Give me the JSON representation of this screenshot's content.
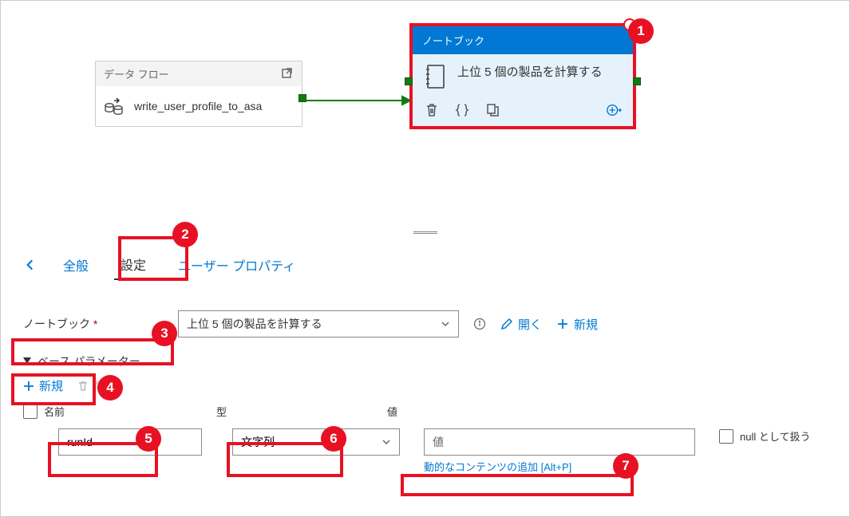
{
  "canvas": {
    "dataflow": {
      "header": "データ フロー",
      "name": "write_user_profile_to_asa"
    },
    "notebook": {
      "header": "ノートブック",
      "name": "上位 5 個の製品を計算する"
    }
  },
  "tabs": {
    "general": "全般",
    "settings": "設定",
    "user_props": "ユーザー プロパティ"
  },
  "form": {
    "notebook_label": "ノートブック",
    "notebook_value": "上位 5 個の製品を計算する",
    "open": "開く",
    "new": "新規"
  },
  "section": {
    "base_params": "ベース パラメーター"
  },
  "param_toolbar": {
    "new": "新規",
    "delete": "削除"
  },
  "param_headers": {
    "name": "名前",
    "type": "型",
    "value": "値"
  },
  "param_row": {
    "name": "runId",
    "type": "文字列",
    "value_placeholder": "値",
    "dyn_link": "動的なコンテンツの追加 [Alt+P]",
    "null_label": "null として扱う"
  },
  "badges": [
    "1",
    "2",
    "3",
    "4",
    "5",
    "6",
    "7"
  ]
}
